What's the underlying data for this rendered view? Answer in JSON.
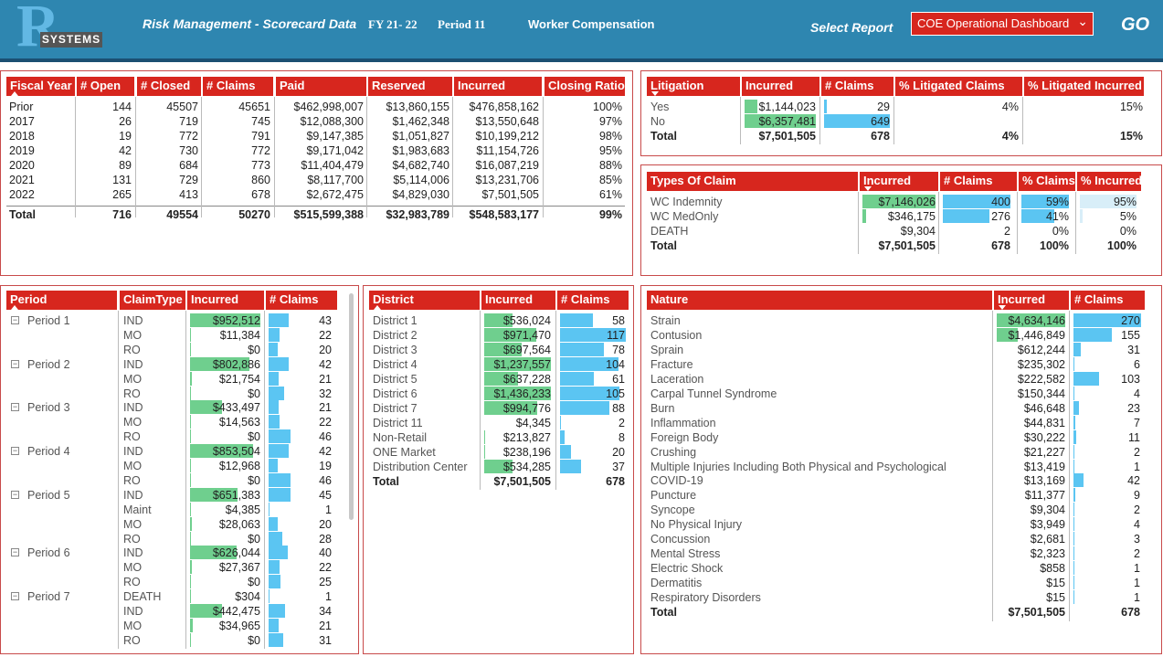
{
  "header": {
    "logo_letter": "R",
    "logo_text": "SYSTEMS",
    "title": "Risk Management - Scorecard  Data",
    "fy": "FY 21- 22",
    "period": "Period 11",
    "category": "Worker Compensation",
    "select_report_label": "Select Report",
    "report_value": "COE Operational Dashboard",
    "go_label": "GO"
  },
  "fiscal": {
    "headers": [
      "Fiscal Year",
      "# Open",
      "# Closed",
      "# Claims",
      "Paid",
      "Reserved",
      "Incurred",
      "Closing Ratio"
    ],
    "rows": [
      [
        "Prior",
        "144",
        "45507",
        "45651",
        "$462,998,007",
        "$13,860,155",
        "$476,858,162",
        "100%"
      ],
      [
        "2017",
        "26",
        "719",
        "745",
        "$12,088,300",
        "$1,462,348",
        "$13,550,648",
        "97%"
      ],
      [
        "2018",
        "19",
        "772",
        "791",
        "$9,147,385",
        "$1,051,827",
        "$10,199,212",
        "98%"
      ],
      [
        "2019",
        "42",
        "730",
        "772",
        "$9,171,042",
        "$1,983,683",
        "$11,154,726",
        "95%"
      ],
      [
        "2020",
        "89",
        "684",
        "773",
        "$11,404,479",
        "$4,682,740",
        "$16,087,219",
        "88%"
      ],
      [
        "2021",
        "131",
        "729",
        "860",
        "$8,117,700",
        "$5,114,006",
        "$13,231,706",
        "85%"
      ],
      [
        "2022",
        "265",
        "413",
        "678",
        "$2,672,475",
        "$4,829,030",
        "$7,501,505",
        "61%"
      ]
    ],
    "total": [
      "Total",
      "716",
      "49554",
      "50270",
      "$515,599,388",
      "$32,983,789",
      "$548,583,177",
      "99%"
    ]
  },
  "litigation": {
    "headers": [
      "Litigation",
      "Incurred",
      "# Claims",
      "% Litigated Claims",
      "% Litigated Incurred"
    ],
    "rows": [
      {
        "label": "Yes",
        "incurred": "$1,144,023",
        "claims": "29",
        "pct_claims": "4%",
        "pct_inc": "15%",
        "inc_frac": 0.18,
        "cl_frac": 0.045
      },
      {
        "label": "No",
        "incurred": "$6,357,481",
        "claims": "649",
        "pct_claims": "",
        "pct_inc": "",
        "inc_frac": 1.0,
        "cl_frac": 1.0
      }
    ],
    "total": [
      "Total",
      "$7,501,505",
      "678",
      "4%",
      "15%"
    ]
  },
  "types": {
    "headers": [
      "Types Of Claim",
      "Incurred",
      "# Claims",
      "% Claims",
      "% Incurred"
    ],
    "rows": [
      {
        "label": "WC Indemnity",
        "incurred": "$7,146,026",
        "claims": "400",
        "pct_claims": "59%",
        "pct_inc": "95%",
        "inc_frac": 1.0,
        "cl_frac": 1.0,
        "pc_frac": 1.0,
        "pi_frac": 1.0
      },
      {
        "label": "WC MedOnly",
        "incurred": "$346,175",
        "claims": "276",
        "pct_claims": "41%",
        "pct_inc": "5%",
        "inc_frac": 0.05,
        "cl_frac": 0.69,
        "pc_frac": 0.69,
        "pi_frac": 0.05
      },
      {
        "label": "DEATH",
        "incurred": "$9,304",
        "claims": "2",
        "pct_claims": "0%",
        "pct_inc": "0%",
        "inc_frac": 0.0,
        "cl_frac": 0.0,
        "pc_frac": 0.0,
        "pi_frac": 0.0
      }
    ],
    "total": [
      "Total",
      "$7,501,505",
      "678",
      "100%",
      "100%"
    ]
  },
  "period": {
    "headers": [
      "Period",
      "ClaimType",
      "Incurred",
      "# Claims"
    ],
    "rows": [
      {
        "period": "Period 1",
        "type": "IND",
        "incurred": "$952,512",
        "claims": "43",
        "inc_frac": 1.0,
        "cl_frac": 0.93
      },
      {
        "period": "",
        "type": "MO",
        "incurred": "$11,384",
        "claims": "22",
        "inc_frac": 0.012,
        "cl_frac": 0.48
      },
      {
        "period": "",
        "type": "RO",
        "incurred": "$0",
        "claims": "20",
        "inc_frac": 0,
        "cl_frac": 0.43
      },
      {
        "period": "Period 2",
        "type": "IND",
        "incurred": "$802,886",
        "claims": "42",
        "inc_frac": 0.84,
        "cl_frac": 0.91
      },
      {
        "period": "",
        "type": "MO",
        "incurred": "$21,754",
        "claims": "21",
        "inc_frac": 0.023,
        "cl_frac": 0.46
      },
      {
        "period": "",
        "type": "RO",
        "incurred": "$0",
        "claims": "32",
        "inc_frac": 0,
        "cl_frac": 0.7
      },
      {
        "period": "Period 3",
        "type": "IND",
        "incurred": "$433,497",
        "claims": "21",
        "inc_frac": 0.46,
        "cl_frac": 0.46
      },
      {
        "period": "",
        "type": "MO",
        "incurred": "$14,563",
        "claims": "22",
        "inc_frac": 0.015,
        "cl_frac": 0.48
      },
      {
        "period": "",
        "type": "RO",
        "incurred": "$0",
        "claims": "46",
        "inc_frac": 0,
        "cl_frac": 1.0
      },
      {
        "period": "Period 4",
        "type": "IND",
        "incurred": "$853,504",
        "claims": "42",
        "inc_frac": 0.9,
        "cl_frac": 0.91
      },
      {
        "period": "",
        "type": "MO",
        "incurred": "$12,968",
        "claims": "19",
        "inc_frac": 0.014,
        "cl_frac": 0.41
      },
      {
        "period": "",
        "type": "RO",
        "incurred": "$0",
        "claims": "46",
        "inc_frac": 0,
        "cl_frac": 1.0
      },
      {
        "period": "Period 5",
        "type": "IND",
        "incurred": "$651,383",
        "claims": "45",
        "inc_frac": 0.68,
        "cl_frac": 0.98
      },
      {
        "period": "",
        "type": "Maint",
        "incurred": "$4,385",
        "claims": "1",
        "inc_frac": 0.005,
        "cl_frac": 0.02
      },
      {
        "period": "",
        "type": "MO",
        "incurred": "$28,063",
        "claims": "20",
        "inc_frac": 0.03,
        "cl_frac": 0.43
      },
      {
        "period": "",
        "type": "RO",
        "incurred": "$0",
        "claims": "28",
        "inc_frac": 0,
        "cl_frac": 0.61
      },
      {
        "period": "Period 6",
        "type": "IND",
        "incurred": "$626,044",
        "claims": "40",
        "inc_frac": 0.66,
        "cl_frac": 0.87
      },
      {
        "period": "",
        "type": "MO",
        "incurred": "$27,367",
        "claims": "22",
        "inc_frac": 0.029,
        "cl_frac": 0.48
      },
      {
        "period": "",
        "type": "RO",
        "incurred": "$0",
        "claims": "25",
        "inc_frac": 0,
        "cl_frac": 0.54
      },
      {
        "period": "Period 7",
        "type": "DEATH",
        "incurred": "$304",
        "claims": "1",
        "inc_frac": 0.0,
        "cl_frac": 0.02
      },
      {
        "period": "",
        "type": "IND",
        "incurred": "$442,475",
        "claims": "34",
        "inc_frac": 0.46,
        "cl_frac": 0.74
      },
      {
        "period": "",
        "type": "MO",
        "incurred": "$34,965",
        "claims": "21",
        "inc_frac": 0.037,
        "cl_frac": 0.46
      },
      {
        "period": "",
        "type": "RO",
        "incurred": "$0",
        "claims": "31",
        "inc_frac": 0,
        "cl_frac": 0.67
      }
    ]
  },
  "district": {
    "headers": [
      "District",
      "Incurred",
      "# Claims"
    ],
    "rows": [
      {
        "label": "District 1",
        "incurred": "$536,024",
        "claims": "58",
        "inc_frac": 0.43,
        "cl_frac": 0.5
      },
      {
        "label": "District 2",
        "incurred": "$971,470",
        "claims": "117",
        "inc_frac": 0.78,
        "cl_frac": 1.0
      },
      {
        "label": "District 3",
        "incurred": "$697,564",
        "claims": "78",
        "inc_frac": 0.56,
        "cl_frac": 0.67
      },
      {
        "label": "District 4",
        "incurred": "$1,237,557",
        "claims": "104",
        "inc_frac": 1.0,
        "cl_frac": 0.89
      },
      {
        "label": "District 5",
        "incurred": "$637,228",
        "claims": "61",
        "inc_frac": 0.51,
        "cl_frac": 0.52
      },
      {
        "label": "District 6",
        "incurred": "$1,436,233",
        "claims": "105",
        "inc_frac": 1.0,
        "cl_frac": 0.9
      },
      {
        "label": "District 7",
        "incurred": "$994,776",
        "claims": "88",
        "inc_frac": 0.8,
        "cl_frac": 0.75
      },
      {
        "label": "District 11",
        "incurred": "$4,345",
        "claims": "2",
        "inc_frac": 0.0,
        "cl_frac": 0.02
      },
      {
        "label": "Non-Retail",
        "incurred": "$213,827",
        "claims": "8",
        "inc_frac": 0.02,
        "cl_frac": 0.07
      },
      {
        "label": "ONE Market",
        "incurred": "$238,196",
        "claims": "20",
        "inc_frac": 0.02,
        "cl_frac": 0.17
      },
      {
        "label": "Distribution Center",
        "incurred": "$534,285",
        "claims": "37",
        "inc_frac": 0.43,
        "cl_frac": 0.32
      }
    ],
    "total": [
      "Total",
      "$7,501,505",
      "678"
    ]
  },
  "nature": {
    "headers": [
      "Nature",
      "Incurred",
      "# Claims"
    ],
    "rows": [
      {
        "label": "Strain",
        "incurred": "$4,634,146",
        "claims": "270",
        "inc_frac": 1.0,
        "cl_frac": 1.0
      },
      {
        "label": "Contusion",
        "incurred": "$1,446,849",
        "claims": "155",
        "inc_frac": 0.31,
        "cl_frac": 0.57
      },
      {
        "label": "Sprain",
        "incurred": "$612,244",
        "claims": "31",
        "inc_frac": 0.0,
        "cl_frac": 0.11
      },
      {
        "label": "Fracture",
        "incurred": "$235,302",
        "claims": "6",
        "inc_frac": 0,
        "cl_frac": 0.02
      },
      {
        "label": "Laceration",
        "incurred": "$222,582",
        "claims": "103",
        "inc_frac": 0,
        "cl_frac": 0.38
      },
      {
        "label": "Carpal Tunnel Syndrome",
        "incurred": "$150,344",
        "claims": "4",
        "inc_frac": 0,
        "cl_frac": 0.015
      },
      {
        "label": "Burn",
        "incurred": "$46,648",
        "claims": "23",
        "inc_frac": 0,
        "cl_frac": 0.085
      },
      {
        "label": "Inflammation",
        "incurred": "$44,831",
        "claims": "7",
        "inc_frac": 0,
        "cl_frac": 0.026
      },
      {
        "label": "Foreign Body",
        "incurred": "$30,222",
        "claims": "11",
        "inc_frac": 0,
        "cl_frac": 0.04
      },
      {
        "label": "Crushing",
        "incurred": "$21,227",
        "claims": "2",
        "inc_frac": 0,
        "cl_frac": 0.007
      },
      {
        "label": "Multiple Injuries Including Both Physical and Psychological",
        "incurred": "$13,419",
        "claims": "1",
        "inc_frac": 0,
        "cl_frac": 0.004
      },
      {
        "label": "COVID-19",
        "incurred": "$13,169",
        "claims": "42",
        "inc_frac": 0,
        "cl_frac": 0.155
      },
      {
        "label": "Puncture",
        "incurred": "$11,377",
        "claims": "9",
        "inc_frac": 0,
        "cl_frac": 0.033
      },
      {
        "label": "Syncope",
        "incurred": "$9,304",
        "claims": "2",
        "inc_frac": 0,
        "cl_frac": 0.007
      },
      {
        "label": "No Physical Injury",
        "incurred": "$3,949",
        "claims": "4",
        "inc_frac": 0,
        "cl_frac": 0.015
      },
      {
        "label": "Concussion",
        "incurred": "$2,681",
        "claims": "3",
        "inc_frac": 0,
        "cl_frac": 0.011
      },
      {
        "label": "Mental Stress",
        "incurred": "$2,323",
        "claims": "2",
        "inc_frac": 0,
        "cl_frac": 0.007
      },
      {
        "label": "Electric Shock",
        "incurred": "$858",
        "claims": "1",
        "inc_frac": 0,
        "cl_frac": 0.004
      },
      {
        "label": "Dermatitis",
        "incurred": "$15",
        "claims": "1",
        "inc_frac": 0,
        "cl_frac": 0.004
      },
      {
        "label": "Respiratory Disorders",
        "incurred": "$15",
        "claims": "1",
        "inc_frac": 0,
        "cl_frac": 0.004
      }
    ],
    "total": [
      "Total",
      "$7,501,505",
      "678"
    ]
  },
  "colors": {
    "header_bg": "#2e86b0",
    "table_header": "#d7261e",
    "green_bar": "#6fcf8e",
    "blue_bar": "#5bc5f2"
  }
}
